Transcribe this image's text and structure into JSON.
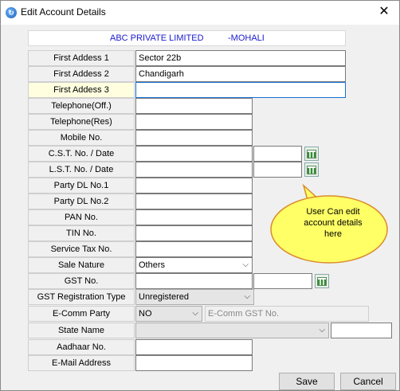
{
  "window": {
    "title": "Edit Account Details",
    "close_label": "✕"
  },
  "banner": {
    "company": "ABC PRIVATE LIMITED",
    "location": "-MOHALI"
  },
  "fields": {
    "address1": {
      "label": "First Addess 1",
      "value": "Sector 22b"
    },
    "address2": {
      "label": "First Addess 2",
      "value": "Chandigarh"
    },
    "address3": {
      "label": "First Addess 3",
      "value": ""
    },
    "tel_off": {
      "label": "Telephone(Off.)",
      "value": ""
    },
    "tel_res": {
      "label": "Telephone(Res)",
      "value": ""
    },
    "mobile": {
      "label": "Mobile No.",
      "value": ""
    },
    "cst": {
      "label": "C.S.T. No. / Date",
      "value": "",
      "date": ""
    },
    "lst": {
      "label": "L.S.T. No. / Date",
      "value": "",
      "date": ""
    },
    "dl1": {
      "label": "Party DL No.1",
      "value": ""
    },
    "dl2": {
      "label": "Party DL No.2",
      "value": ""
    },
    "pan": {
      "label": "PAN No.",
      "value": ""
    },
    "tin": {
      "label": "TIN No.",
      "value": ""
    },
    "service_tax": {
      "label": "Service Tax No.",
      "value": ""
    },
    "sale_nature": {
      "label": "Sale Nature",
      "value": "Others"
    },
    "gst": {
      "label": "GST No.",
      "value": "",
      "date": ""
    },
    "gst_type": {
      "label": "GST Registration Type",
      "value": "Unregistered"
    },
    "ecomm": {
      "label": "E-Comm Party",
      "value": "NO",
      "gst_placeholder": "E-Comm GST No."
    },
    "state": {
      "label": "State Name",
      "value": "",
      "code": ""
    },
    "aadhaar": {
      "label": "Aadhaar No.",
      "value": ""
    },
    "email": {
      "label": "E-Mail Address",
      "value": ""
    }
  },
  "callout": {
    "text": "User  Can  edit account  details here",
    "color": "#ffff66"
  },
  "buttons": {
    "save": "Save",
    "cancel": "Cancel"
  },
  "icons": {
    "calendar": "calendar-icon",
    "dropdown": "chevron-down-icon"
  }
}
